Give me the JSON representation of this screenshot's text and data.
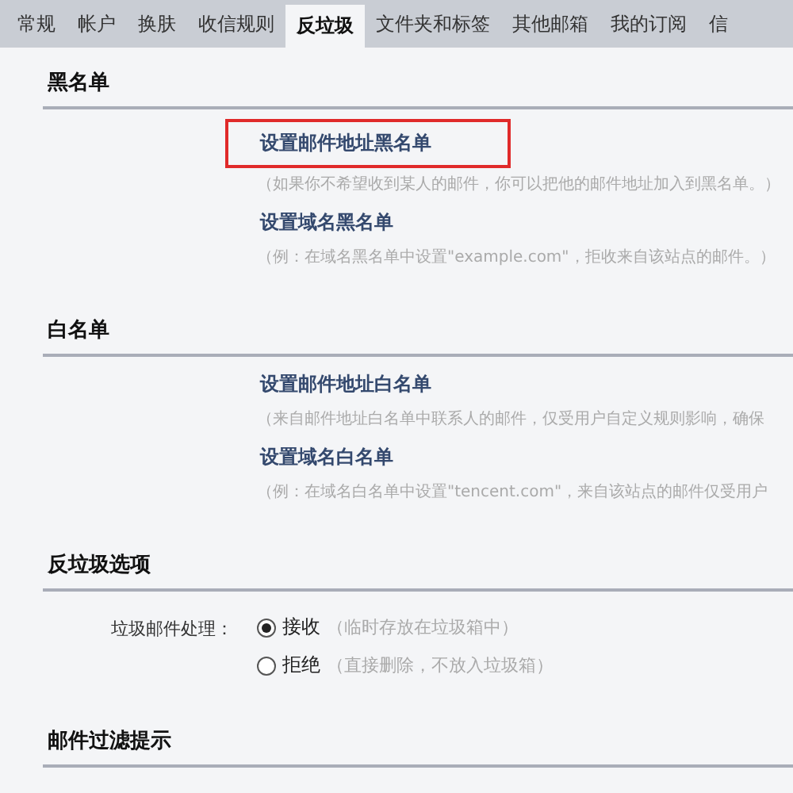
{
  "tabs": [
    {
      "label": "常规",
      "selected": false
    },
    {
      "label": "帐户",
      "selected": false
    },
    {
      "label": "换肤",
      "selected": false
    },
    {
      "label": "收信规则",
      "selected": false
    },
    {
      "label": "反垃圾",
      "selected": true
    },
    {
      "label": "文件夹和标签",
      "selected": false
    },
    {
      "label": "其他邮箱",
      "selected": false
    },
    {
      "label": "我的订阅",
      "selected": false
    },
    {
      "label": "信",
      "selected": false
    }
  ],
  "sections": [
    {
      "kind": "links",
      "title": "黑名单",
      "items": [
        {
          "link": "设置邮件地址黑名单",
          "highlighted": true,
          "description": "（如果你不希望收到某人的邮件，你可以把他的邮件地址加入到黑名单。）"
        },
        {
          "link": "设置域名黑名单",
          "highlighted": false,
          "description": "（例：在域名黑名单中设置\"example.com\"，拒收来自该站点的邮件。）"
        }
      ]
    },
    {
      "kind": "links",
      "title": "白名单",
      "items": [
        {
          "link": "设置邮件地址白名单",
          "highlighted": false,
          "description": "（来自邮件地址白名单中联系人的邮件，仅受用户自定义规则影响，确保"
        },
        {
          "link": "设置域名白名单",
          "highlighted": false,
          "description": "（例：在域名白名单中设置\"tencent.com\"，来自该站点的邮件仅受用户"
        }
      ]
    },
    {
      "kind": "radios",
      "title": "反垃圾选项",
      "label": "垃圾邮件处理：",
      "options": [
        {
          "label": "接收",
          "hint": "（临时存放在垃圾箱中）",
          "selected": true
        },
        {
          "label": "拒绝",
          "hint": "（直接删除，不放入垃圾箱）",
          "selected": false
        }
      ]
    },
    {
      "kind": "heading",
      "title": "邮件过滤提示"
    }
  ]
}
